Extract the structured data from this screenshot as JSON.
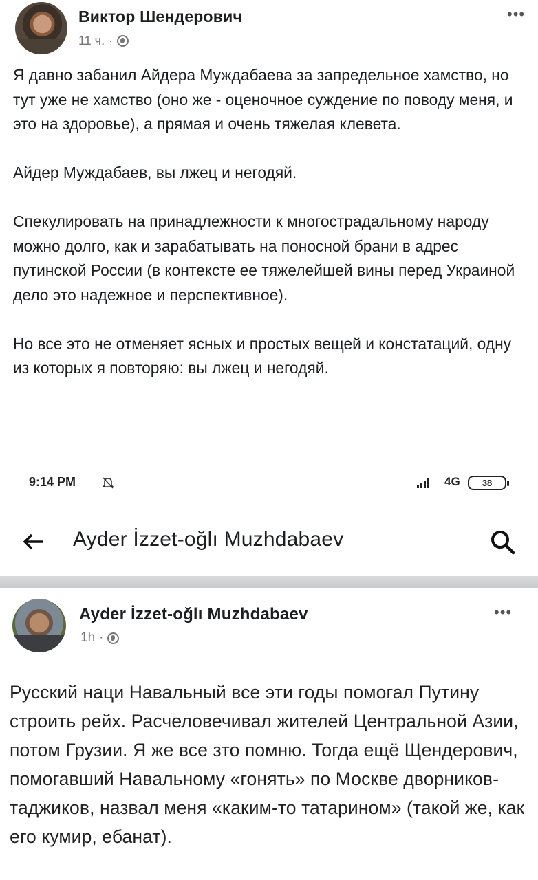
{
  "post": {
    "author": "Виктор Шендерович",
    "time": "11 ч.",
    "separator": "·",
    "more": "•••",
    "paragraphs": [
      "Я давно забанил Айдера Муждабаева за запредельное хамство, но тут уже не хамство (оно же - оценочное суждение по поводу меня, и это на здоровье), а прямая и очень тяжелая клевета.",
      "Айдер Муждабаев, вы лжец и негодяй.",
      "Спекулировать на принадлежности к многострадальному народу можно долго, как и зарабатывать на поносной брани в адрес путинской России (в контексте ее тяжелейшей вины перед Украиной дело это надежное и перспективное).",
      "Но все это не отменяет ясных и простых вещей и констатаций, одну из которых я повторяю: вы лжец и негодяй."
    ]
  },
  "screenshot": {
    "status_bar": {
      "time": "9:14 PM",
      "network": "4G",
      "battery": "38"
    },
    "search_bar": {
      "title": "Ayder İzzet-oğlı Muzhdabaev"
    },
    "post": {
      "author": "Ayder İzzet-oğlı Muzhdabaev",
      "time": "1h",
      "separator": "·",
      "more": "•••",
      "text": "Русский наци Навальный все эти годы помогал Путину строить рейх. Расчеловечивал жителей Центральной Азии, потом Грузии. Я же все зто помню. Тогда ещё Щендерович, помогавший Навальному «гонять» по Москве дворников-таджиков, назвал меня «каким-то татарином» (такой же, как его кумир, ебанат)."
    }
  },
  "icons": {
    "globe": "globe-icon",
    "back": "arrow-left-icon",
    "search": "search-icon",
    "mute": "bell-off-icon",
    "signal": "signal-icon",
    "battery": "battery-icon"
  }
}
